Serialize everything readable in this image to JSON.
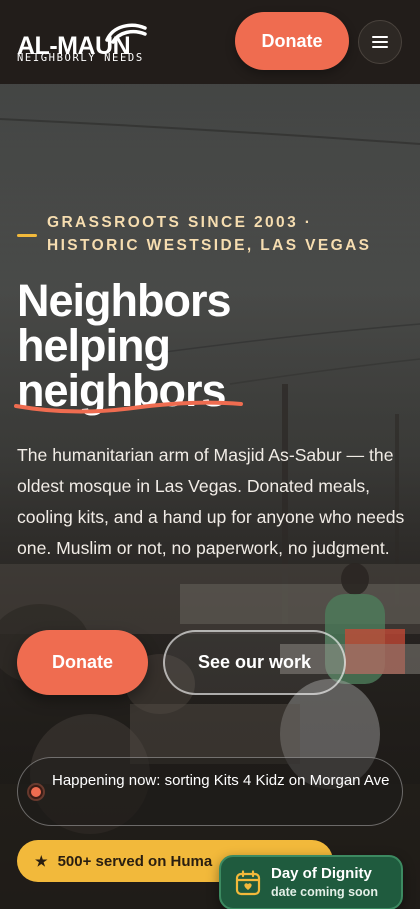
{
  "header": {
    "logo_name": "AL-MAUN",
    "logo_tagline": "NEIGHBORLY NEEDS",
    "donate_label": "Donate",
    "menu_icon": "hamburger-menu-icon"
  },
  "hero": {
    "kicker": "Grassroots since 2003 · Historic Westside, Las Vegas",
    "headline_line1": "Neighbors",
    "headline_line2": "helping",
    "headline_line3": "neighbors",
    "lead": "The humanitarian arm of Masjid As-Sabur — the oldest mosque in Las Vegas. Donated meals, cooling kits, and a hand up for anyone who needs one. Muslim or not, no paperwork, no judgment.",
    "donate_label": "Donate",
    "work_label": "See our work"
  },
  "status": {
    "happening_text": "Happening now: sorting Kits 4 Kidz on Morgan Ave",
    "served_text": "500+ served on Huma"
  },
  "event_badge": {
    "title": "Day of Dignity",
    "subtitle": "date coming soon",
    "icon": "calendar-heart-icon"
  },
  "colors": {
    "accent": "#ef6c50",
    "gold": "#f2b93b",
    "green": "#1f5b3e",
    "header_bg": "#221d1a"
  }
}
